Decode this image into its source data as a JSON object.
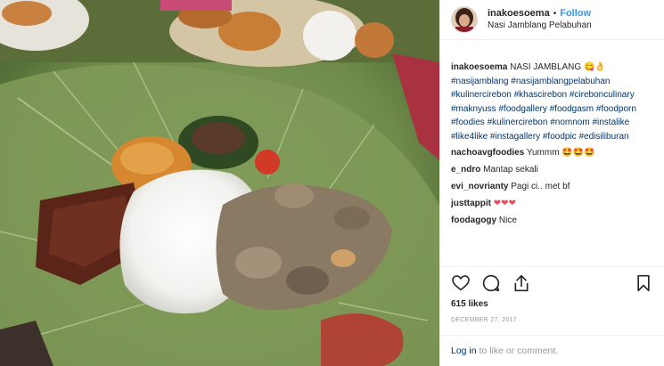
{
  "header": {
    "username": "inakoesoema",
    "separator": "•",
    "follow_label": "Follow",
    "location": "Nasi Jamblang Pelabuhan"
  },
  "caption": {
    "username": "inakoesoema",
    "title": "NASI JAMBLANG",
    "emojis": "😋👌",
    "hashtags": [
      "#nasijamblang",
      "#nasijamblangpelabuhan",
      "#kulinercirebon",
      "#khascirebon",
      "#cirebonculinary",
      "#maknyuss",
      "#foodgallery",
      "#foodgasm",
      "#foodporn",
      "#foodies",
      "#kulinercirebon",
      "#nomnom",
      "#instalike",
      "#like4like",
      "#instagallery",
      "#foodpic",
      "#edisiliburan"
    ]
  },
  "comments": [
    {
      "username": "nachoavgfoodies",
      "text": "Yummm",
      "emojis": "🤩🤩🤩"
    },
    {
      "username": "e_ndro",
      "text": "Mantap sekali",
      "emojis": ""
    },
    {
      "username": "evi_novrianty",
      "text": "Pagi ci.. met bf",
      "emojis": ""
    },
    {
      "username": "justtappit",
      "text": "",
      "emojis": "❤❤❤"
    },
    {
      "username": "foodagogy",
      "text": "Nice",
      "emojis": ""
    }
  ],
  "likes": "615 likes",
  "date": "DECEMBER 27, 2017",
  "login": {
    "link": "Log in",
    "rest": "to like or comment."
  },
  "icons": {
    "like": "heart-outline-icon",
    "comment": "comment-bubble-icon",
    "share": "share-arrow-icon",
    "save": "bookmark-icon"
  },
  "colors": {
    "link": "#3897f0",
    "hashtag": "#003569",
    "muted": "#999999"
  }
}
